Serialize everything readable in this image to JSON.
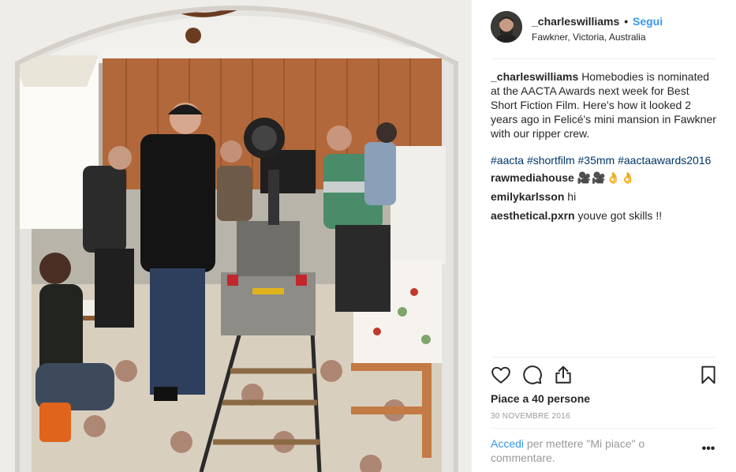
{
  "post": {
    "photo_alt_icon": "film-set-photo",
    "author": {
      "username": "_charleswilliams",
      "separator": "•",
      "follow_label": "Segui",
      "location": "Fawkner, Victoria, Australia"
    },
    "caption": {
      "username": "_charleswilliams",
      "text": "Homebodies is nominated at the AACTA Awards next week for Best Short Fiction Film. Here's how it looked 2 years ago in Felicé's mini mansion in Fawkner with our ripper crew."
    },
    "hashtags": [
      "#aacta",
      "#shortfilm",
      "#35mm",
      "#aactaawards2016"
    ],
    "comments": [
      {
        "username": "rawmediahouse",
        "text": "🎥🎥👌👌"
      },
      {
        "username": "emilykarlsson",
        "text": "hi"
      },
      {
        "username": "aesthetical.pxrn",
        "text": "youve got skills !!"
      }
    ],
    "actions": {
      "like_icon": "heart-icon",
      "comment_icon": "comment-bubble-icon",
      "share_icon": "share-icon",
      "save_icon": "bookmark-icon"
    },
    "likes_text": "Piace a 40 persone",
    "date": "30 NOVEMBRE 2016",
    "login": {
      "link_label": "Accedi",
      "text": "per mettere \"Mi piace\" o commentare."
    },
    "more_label": "•••"
  },
  "colors": {
    "link_blue": "#3897f0",
    "hashtag_blue": "#003569",
    "muted_gray": "#999999",
    "text": "#262626",
    "divider": "#efefef"
  }
}
